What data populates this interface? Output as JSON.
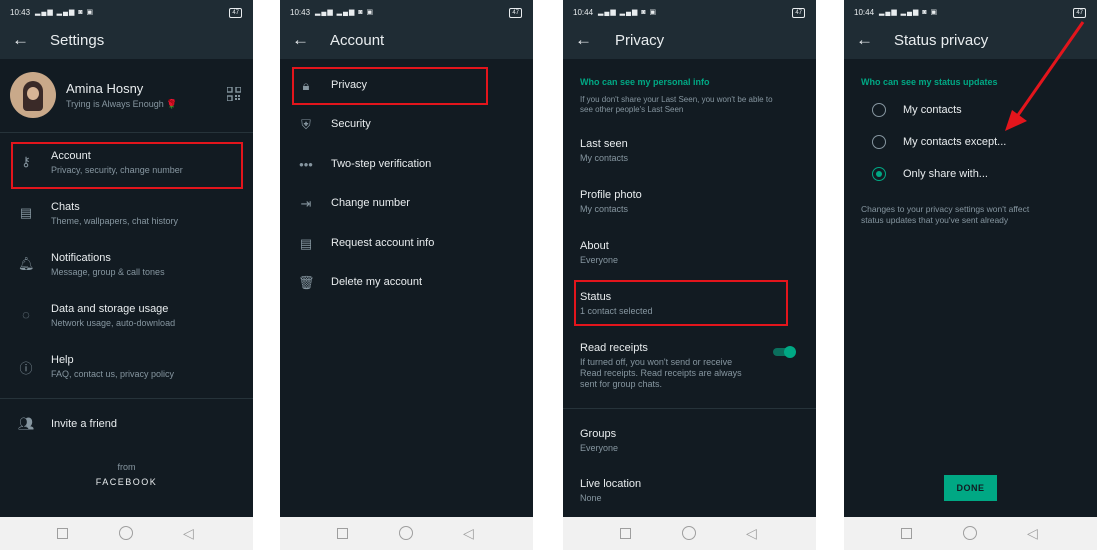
{
  "statusbar": [
    {
      "time": "10:43",
      "battery": "47"
    },
    {
      "time": "10:43",
      "battery": "47"
    },
    {
      "time": "10:44",
      "battery": "47"
    },
    {
      "time": "10:44",
      "battery": "47"
    }
  ],
  "screen1": {
    "title": "Settings",
    "profile": {
      "name": "Amina Hosny",
      "status": "Trying is Always Enough 🌹"
    },
    "items": [
      {
        "label": "Account",
        "sub": "Privacy, security, change number"
      },
      {
        "label": "Chats",
        "sub": "Theme, wallpapers, chat history"
      },
      {
        "label": "Notifications",
        "sub": "Message, group & call tones"
      },
      {
        "label": "Data and storage usage",
        "sub": "Network usage, auto-download"
      },
      {
        "label": "Help",
        "sub": "FAQ, contact us, privacy policy"
      }
    ],
    "invite": "Invite a friend",
    "from": "from",
    "brand": "FACEBOOK"
  },
  "screen2": {
    "title": "Account",
    "items": [
      {
        "label": "Privacy"
      },
      {
        "label": "Security"
      },
      {
        "label": "Two-step verification"
      },
      {
        "label": "Change number"
      },
      {
        "label": "Request account info"
      },
      {
        "label": "Delete my account"
      }
    ]
  },
  "screen3": {
    "title": "Privacy",
    "section": "Who can see my personal info",
    "note_line1": "If you don't share your Last Seen, you won't be able to",
    "note_line2": "see other people's Last Seen",
    "items": [
      {
        "label": "Last seen",
        "sub": "My contacts"
      },
      {
        "label": "Profile photo",
        "sub": "My contacts"
      },
      {
        "label": "About",
        "sub": "Everyone"
      },
      {
        "label": "Status",
        "sub": "1 contact selected"
      }
    ],
    "read_receipts": {
      "label": "Read receipts",
      "line1": "If turned off, you won't send or receive",
      "line2": "Read receipts. Read receipts are always",
      "line3": "sent for group chats.",
      "enabled": true
    },
    "groups": {
      "label": "Groups",
      "sub": "Everyone"
    },
    "live_location": {
      "label": "Live location",
      "sub": "None"
    }
  },
  "screen4": {
    "title": "Status privacy",
    "section": "Who can see my status updates",
    "options": [
      {
        "label": "My contacts",
        "selected": false
      },
      {
        "label": "My contacts except...",
        "selected": false
      },
      {
        "label": "Only share with...",
        "selected": true
      }
    ],
    "note_line1": "Changes to your privacy settings won't affect",
    "note_line2": "status updates that you've sent already",
    "done": "DONE"
  },
  "colors": {
    "background": "#121b22",
    "appbar": "#1f2c34",
    "accent": "#00a884",
    "highlight": "#e3151c",
    "text": "#e9edef",
    "subtext": "#8696a0"
  }
}
